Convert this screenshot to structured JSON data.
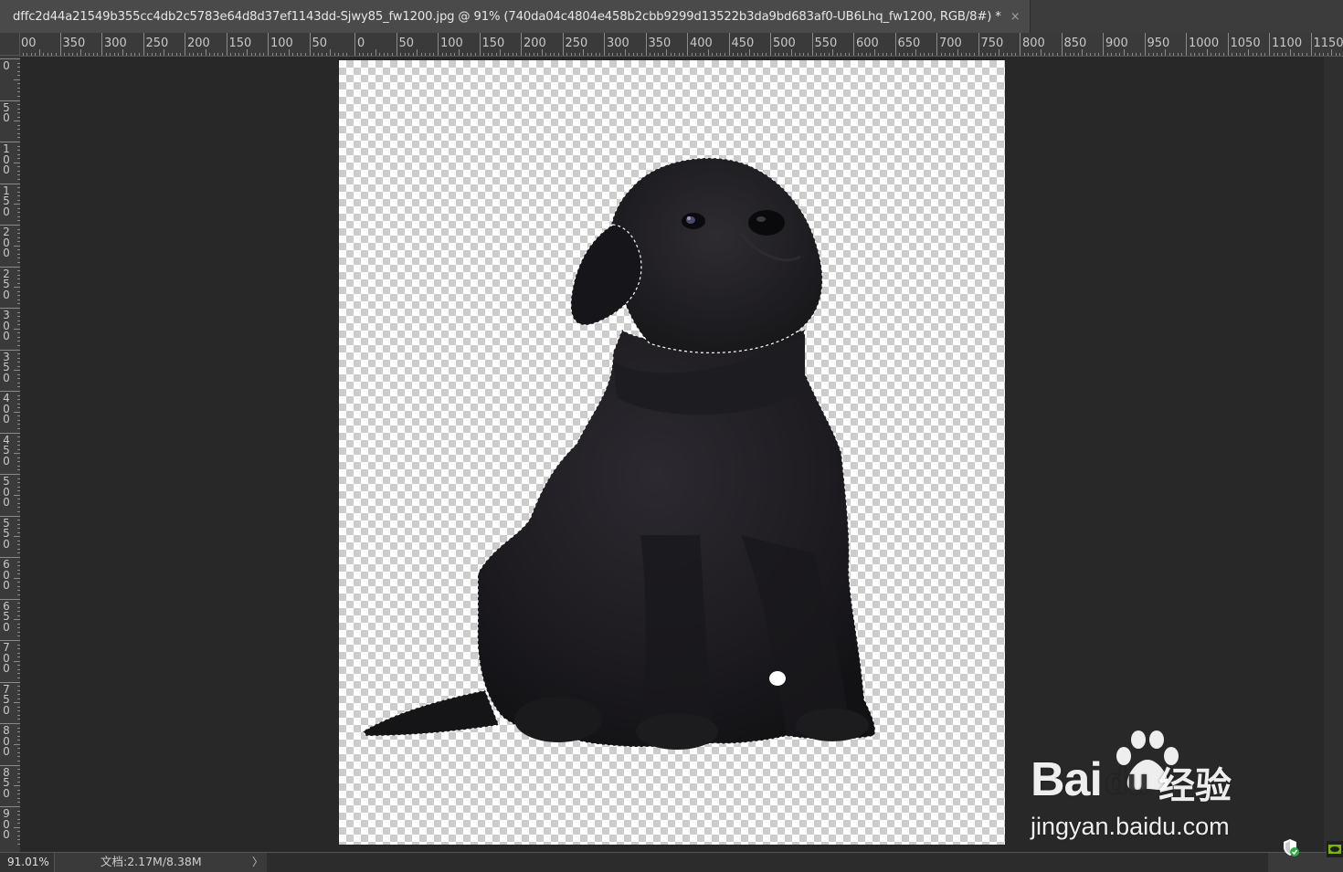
{
  "document_tab": {
    "title": "dffc2d44a21549b355cc4db2c5783e64d8d37ef1143dd-Sjwy85_fw1200.jpg @ 91% (740da04c4804e458b2cbb9299d13522b3da9bd683af0-UB6Lhq_fw1200, RGB/8#) *",
    "close_glyph": "×"
  },
  "ruler_h_labels": [
    "00",
    "350",
    "300",
    "250",
    "200",
    "150",
    "100",
    "50",
    "0",
    "50",
    "100",
    "150",
    "200",
    "250",
    "300",
    "350",
    "400",
    "450",
    "500",
    "550",
    "600",
    "650",
    "700",
    "750",
    "800",
    "850",
    "900",
    "950",
    "1000",
    "1050",
    "1100",
    "1150"
  ],
  "ruler_v_labels": [
    "0",
    "50",
    "100",
    "150",
    "200",
    "250",
    "300",
    "350",
    "400",
    "450",
    "500",
    "550",
    "600",
    "650",
    "700",
    "750",
    "800",
    "850",
    "900"
  ],
  "canvas": {
    "subject": "black-puppy-cutout",
    "transparent_pattern_colors": [
      "#ffffff",
      "#cccccc"
    ],
    "selection": "marching-ants"
  },
  "watermark": {
    "brand": "Bai",
    "brand_suffix": "du",
    "chinese": "经验",
    "url": "jingyan.baidu.com"
  },
  "status": {
    "zoom": "91.01%",
    "doc_info": "文档:2.17M/8.38M",
    "arrow": "〉"
  },
  "colors": {
    "app_bg": "#282828",
    "tab_bg": "#4a4a4a",
    "ruler_bg": "#3a3a3a",
    "puppy": "#1b191d"
  }
}
